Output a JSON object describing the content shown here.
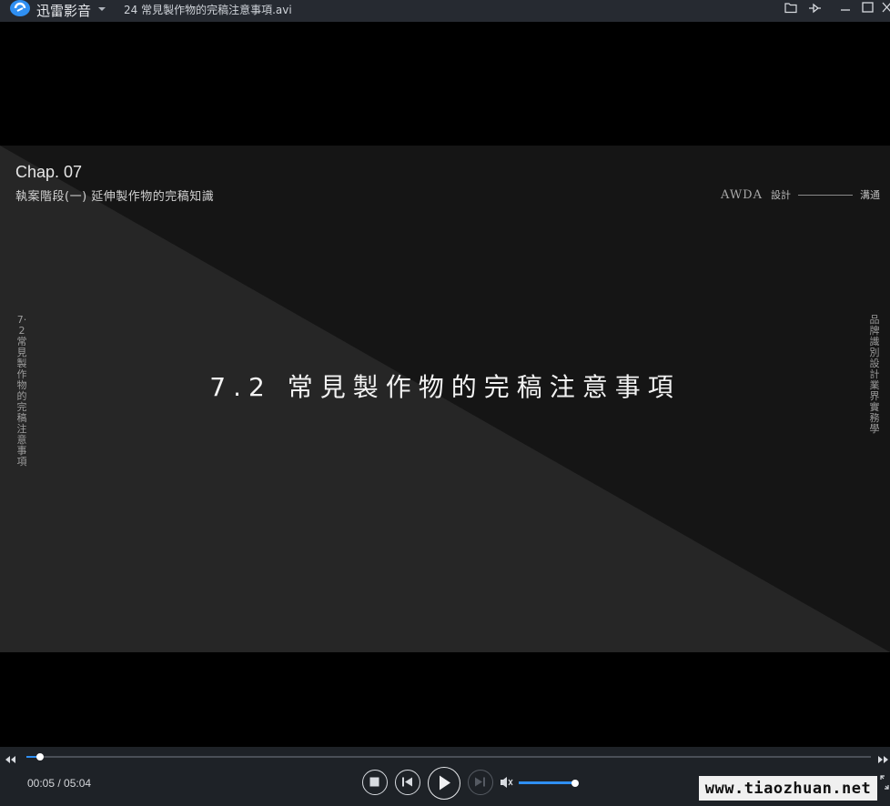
{
  "titlebar": {
    "app_name": "迅雷影音",
    "file_title": "24 常見製作物的完稿注意事項.avi",
    "icons": [
      "app-logo-icon",
      "menu-caret-icon",
      "folder-icon",
      "pin-icon",
      "minimize-icon",
      "maximize-icon",
      "close-icon"
    ]
  },
  "slide": {
    "chapter": "Chap. 07",
    "chapter_subtitle": "執案階段(一) 延伸製作物的完稿知識",
    "brand_logo": "AWDA",
    "brand_word1": "設計",
    "brand_word2": "溝通",
    "main_title": "7.2 常見製作物的完稿注意事項",
    "left_vertical": "7·2常見製作物的完稿注意事項",
    "right_vertical": "品牌識別設計業界實務學"
  },
  "controls": {
    "time_current": "00:05",
    "time_total": "05:04",
    "time_display": "00:05 / 05:04",
    "progress_fraction": 0.016,
    "volume_fraction": 1.0,
    "accent_color": "#2f8ff2",
    "icons": [
      "seek-back-icon",
      "seek-forward-icon",
      "stop-icon",
      "previous-icon",
      "play-icon",
      "next-icon",
      "volume-icon",
      "fullscreen-icon"
    ]
  },
  "watermark": {
    "text": "www.tiaozhuan.net"
  }
}
